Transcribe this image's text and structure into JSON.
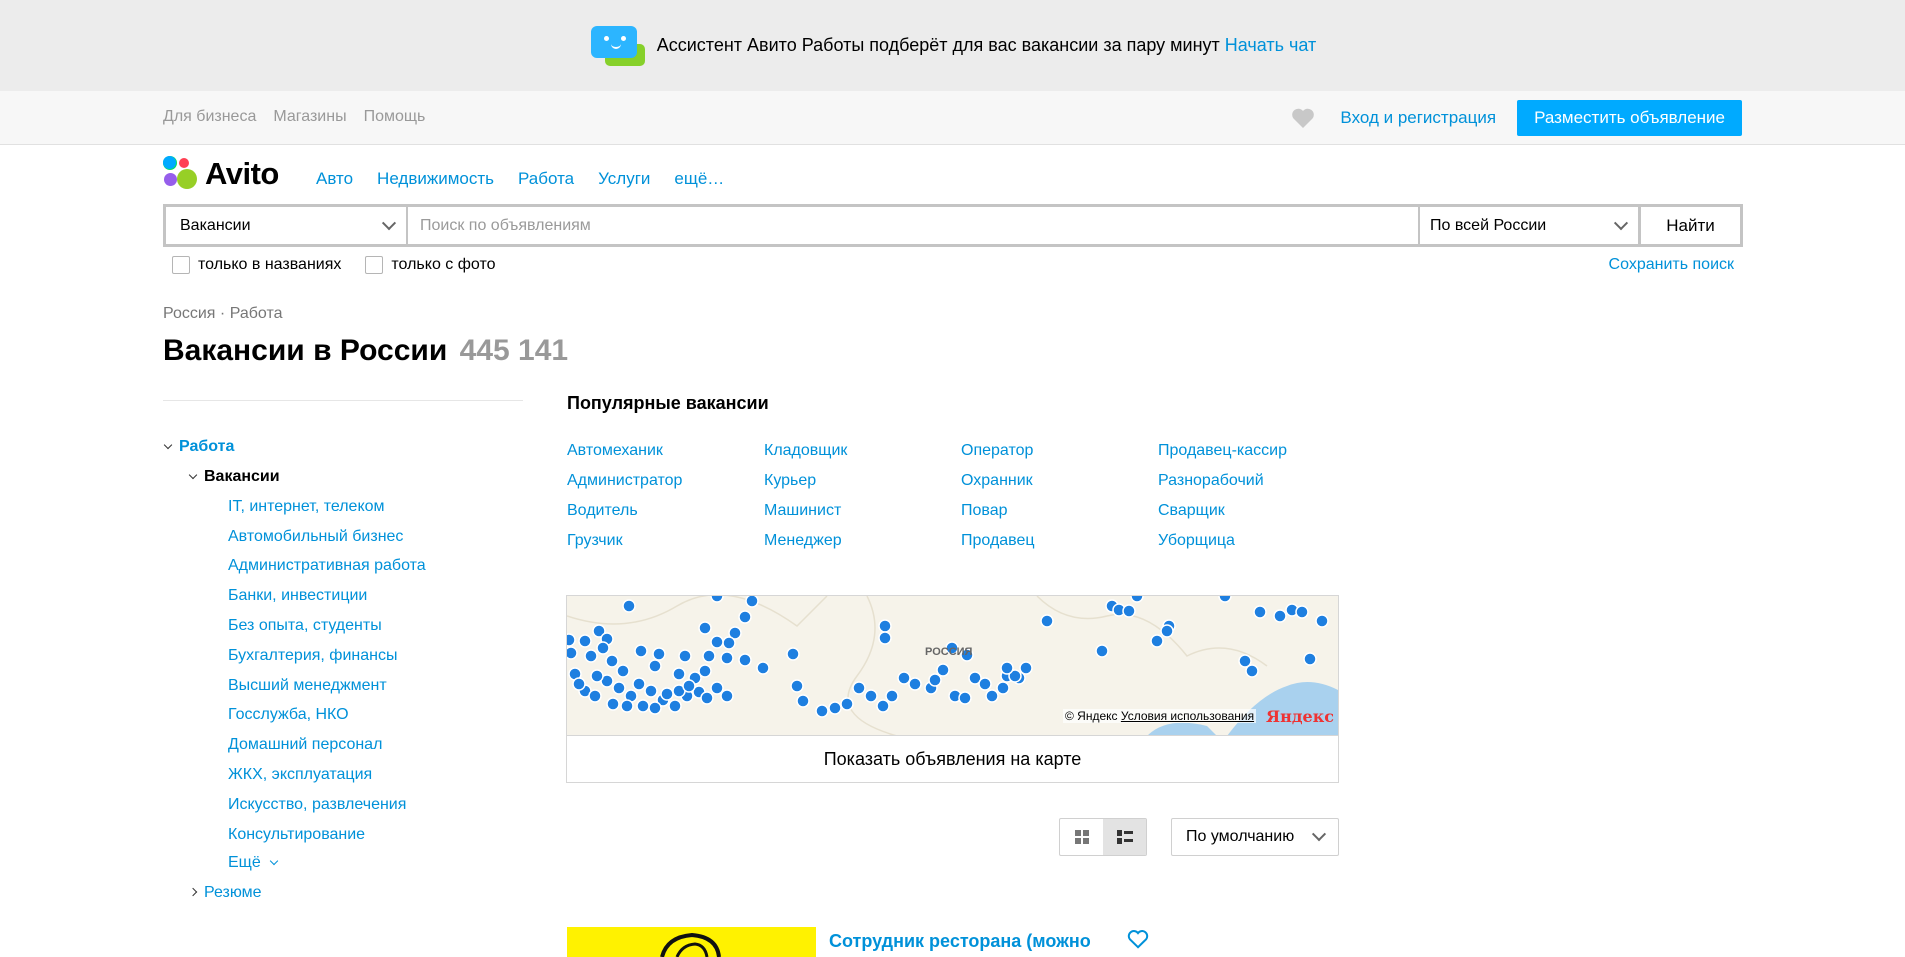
{
  "banner": {
    "text": "Ассистент Авито Работы подберёт для вас вакансии за пару минут",
    "link": "Начать чат"
  },
  "subnav": {
    "left": [
      "Для бизнеса",
      "Магазины",
      "Помощь"
    ],
    "login": "Вход и регистрация",
    "post": "Разместить объявление"
  },
  "logo": "Avito",
  "categories": [
    "Авто",
    "Недвижимость",
    "Работа",
    "Услуги",
    "ещё…"
  ],
  "search": {
    "category": "Вакансии",
    "placeholder": "Поиск по объявлениям",
    "region": "По всей России",
    "button": "Найти"
  },
  "filters": {
    "titles_only": "только в названиях",
    "photo_only": "только с фото",
    "save_search": "Сохранить поиск"
  },
  "breadcrumb": "Россия · Работа",
  "title": "Вакансии в России",
  "count": "445 141",
  "sidebar": {
    "root": "Работа",
    "current": "Вакансии",
    "items": [
      "IT, интернет, телеком",
      "Автомобильный бизнес",
      "Административная работа",
      "Банки, инвестиции",
      "Без опыта, студенты",
      "Бухгалтерия, финансы",
      "Высший менеджмент",
      "Госслужба, НКО",
      "Домашний персонал",
      "ЖКХ, эксплуатация",
      "Искусство, развлечения",
      "Консультирование"
    ],
    "more": "Ещё",
    "resume": "Резюме"
  },
  "popular": {
    "title": "Популярные вакансии",
    "items": [
      "Автомеханик",
      "Кладовщик",
      "Оператор",
      "Продавец-кассир",
      "Администратор",
      "Курьер",
      "Охранник",
      "Разнорабочий",
      "Водитель",
      "Машинист",
      "Повар",
      "Сварщик",
      "Грузчик",
      "Менеджер",
      "Продавец",
      "Уборщица"
    ]
  },
  "map": {
    "label": "РОССИЯ",
    "copyright": "© Яндекс",
    "terms": "Условия использования",
    "brand": "Яндекс",
    "button": "Показать объявления на карте"
  },
  "sort": "По умолчанию",
  "listing": {
    "title": "Сотрудник ресторана (можно"
  },
  "colors": {
    "link": "#0091d9",
    "accent": "#00aaff",
    "pin": "#1e7fe0"
  }
}
